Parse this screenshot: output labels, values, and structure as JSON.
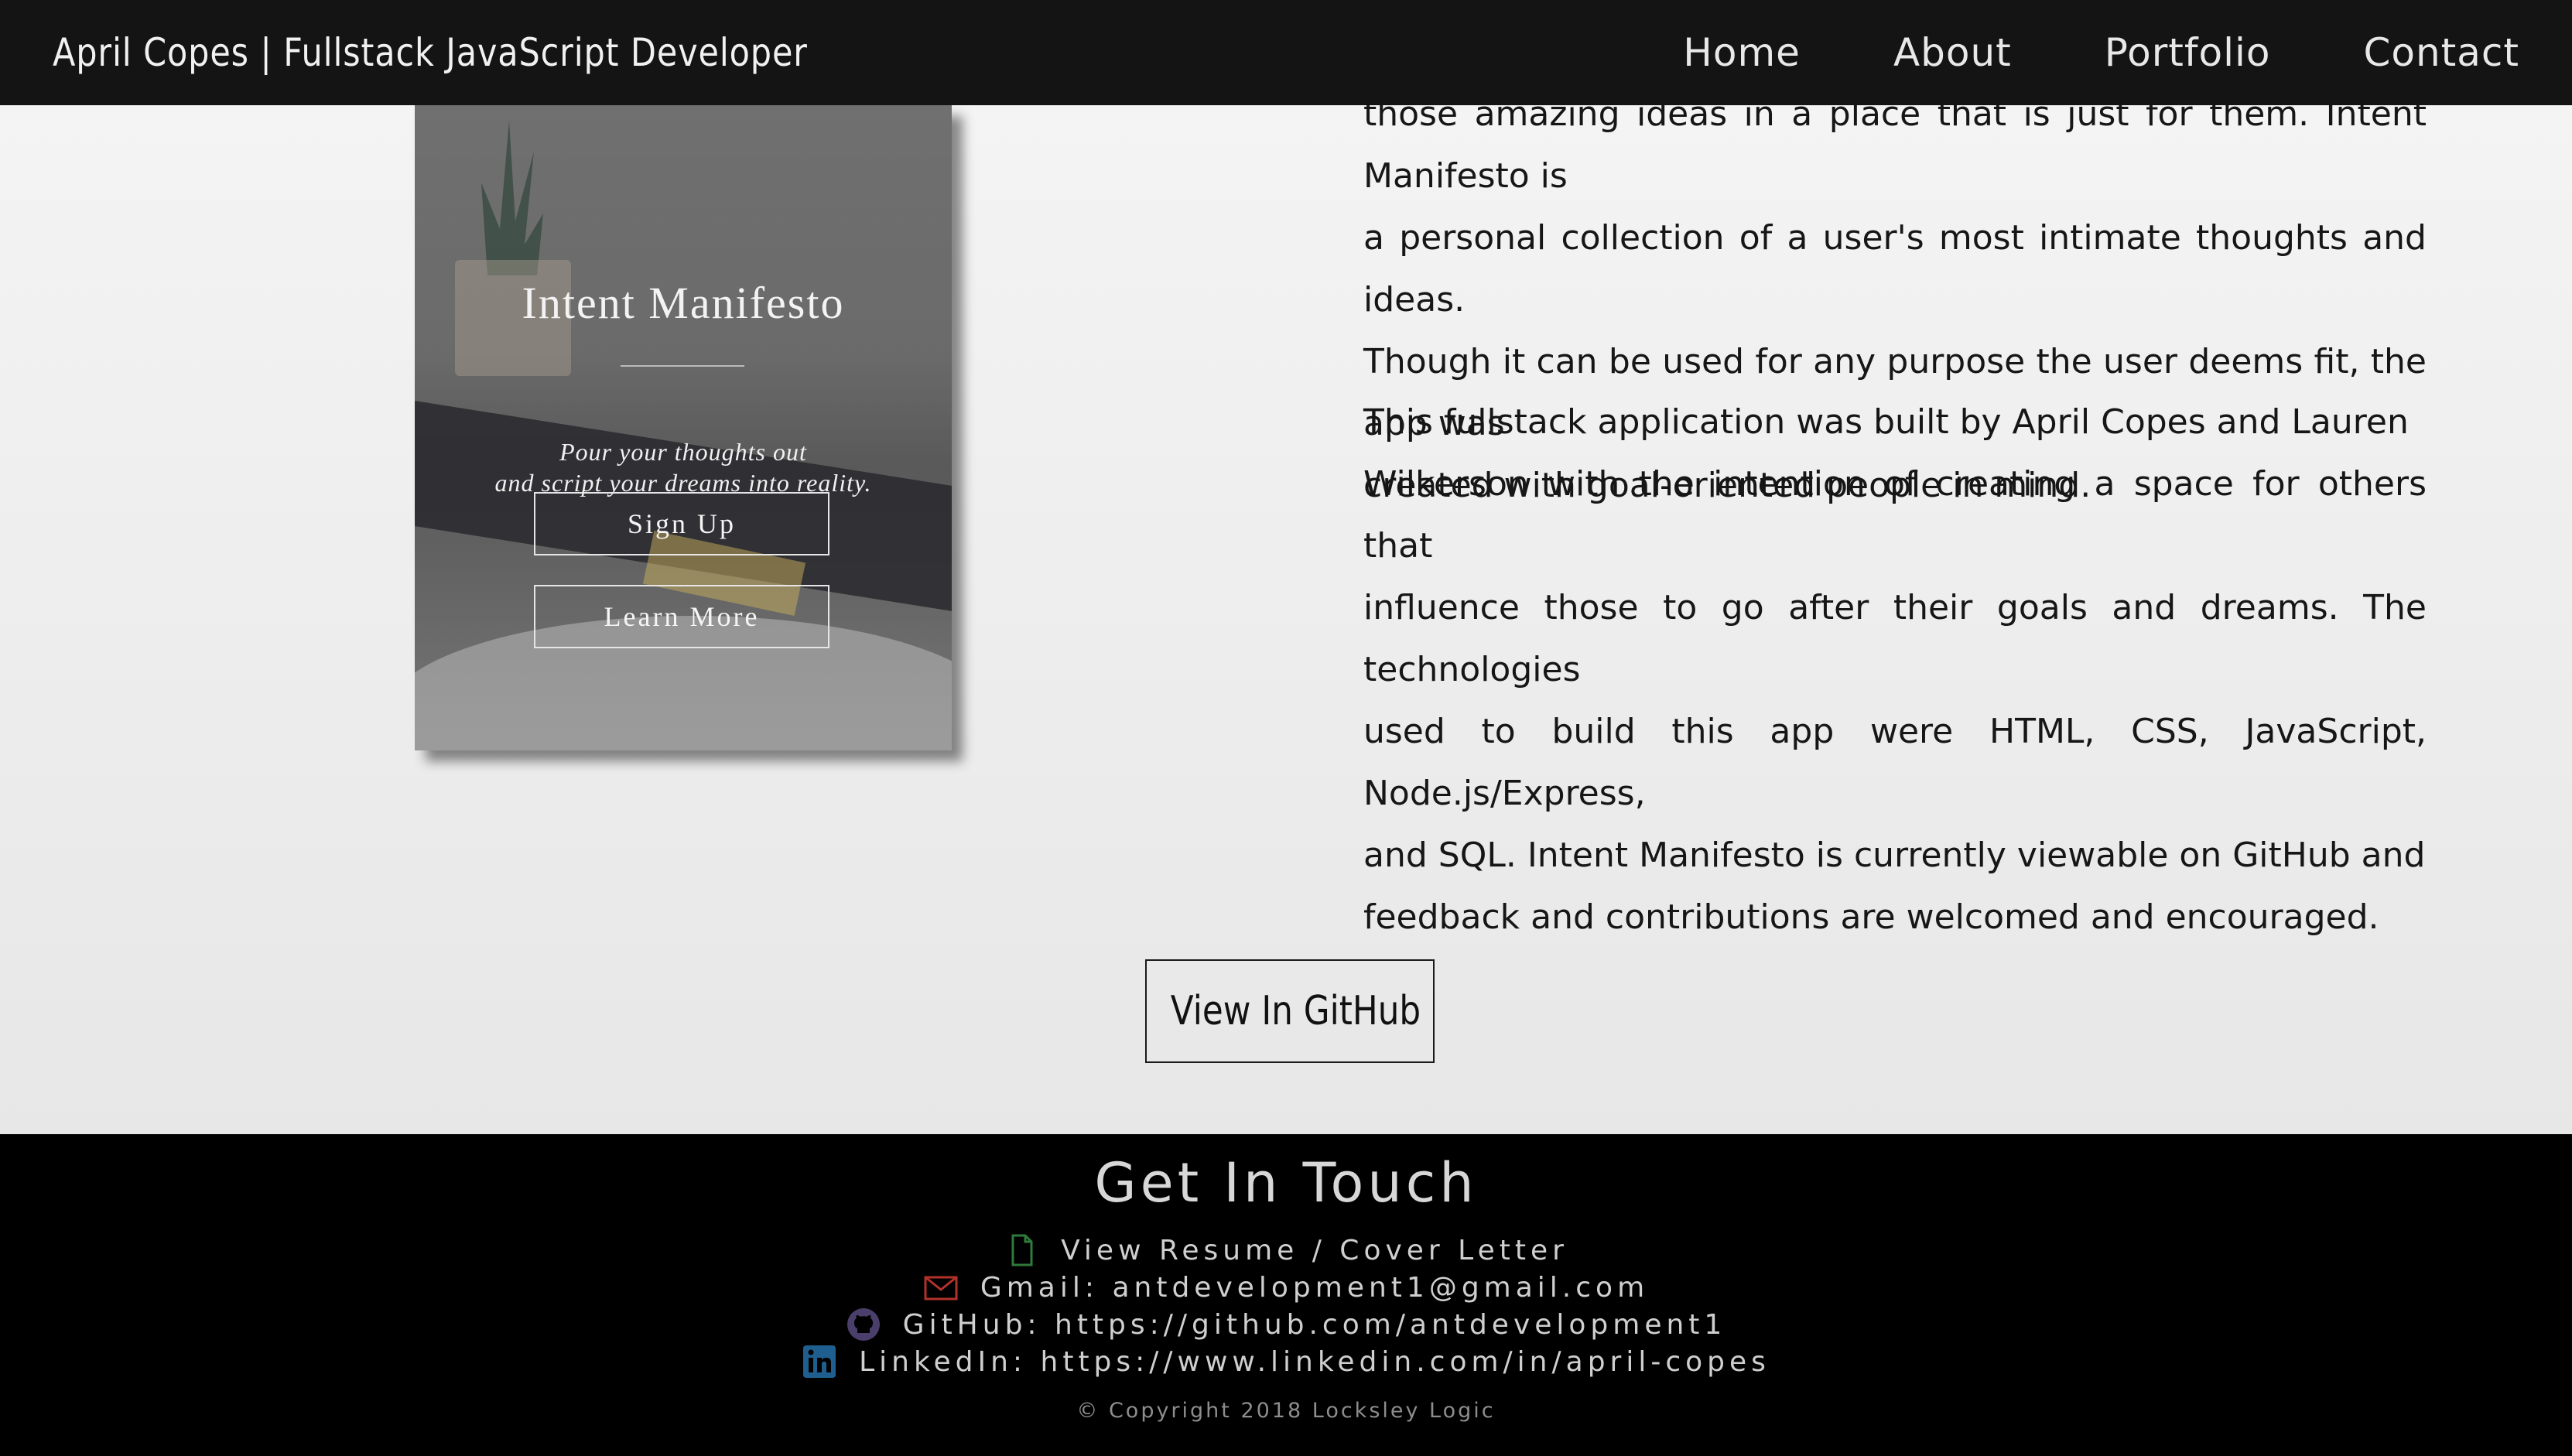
{
  "navbar": {
    "brand": "April Copes | Fullstack JavaScript Developer",
    "links": [
      "Home",
      "About",
      "Portfolio",
      "Contact"
    ]
  },
  "project": {
    "mockup": {
      "title": "Intent Manifesto",
      "tagline_line1": "Pour your thoughts out",
      "tagline_line2": "and script your dreams into reality.",
      "signup_label": "Sign Up",
      "learn_more_label": "Learn More"
    },
    "paragraph1_lines": [
      "those amazing ideas in a place that is just for them. Intent Manifesto is",
      "a personal collection of a user's most intimate thoughts and ideas.",
      "Though it can be used for any purpose the user deems fit, the app was",
      "created with goal-oriented people in mind."
    ],
    "paragraph2_lines": [
      "This fullstack application was built by April Copes and Lauren",
      "Wilkerson with the intention of creating a space for others that",
      "influence those to go after their goals and dreams. The technologies",
      "used to build this app were HTML, CSS, JavaScript, Node.js/Express,",
      "and SQL. Intent Manifesto is currently viewable on GitHub and",
      "feedback and contributions are welcomed and encouraged."
    ],
    "github_button_label": "View In GitHub"
  },
  "footer": {
    "title": "Get In Touch",
    "contacts": [
      {
        "icon": "file-icon",
        "text": "View Resume / Cover Letter",
        "color": "#2f7a3c"
      },
      {
        "icon": "envelope-icon",
        "text": "Gmail: antdevelopment1@gmail.com",
        "color": "#b2322b"
      },
      {
        "icon": "github-icon",
        "text": "GitHub: https://github.com/antdevelopment1",
        "color": "#4a3f6b"
      },
      {
        "icon": "linkedin-icon",
        "text": "LinkedIn: https://www.linkedin.com/in/april-copes",
        "color": "#1f5f8f"
      }
    ],
    "copyright": "© Copyright 2018 Locksley Logic"
  }
}
